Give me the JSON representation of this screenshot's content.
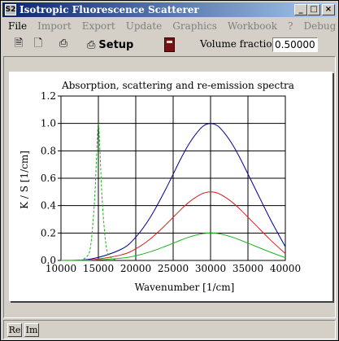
{
  "window": {
    "title": "Isotropic Fluorescence Scatterer",
    "icon_text": "S2",
    "controls": {
      "minimize": "_",
      "maximize": "□",
      "close": "×"
    }
  },
  "menu": [
    "File",
    "Import",
    "Export",
    "Update",
    "Graphics",
    "Workbook",
    "?",
    "Debug"
  ],
  "toolbar": {
    "icons": [
      "new-document-icon",
      "open-document-icon",
      "print-icon",
      "print-setup-icon",
      "device-icon"
    ],
    "setup_label": "Setup",
    "volume_fraction_label": "Volume fraction:",
    "volume_fraction_value": "0.50000"
  },
  "status": {
    "re_label": "Re",
    "im_label": "Im"
  },
  "chart_data": {
    "type": "line",
    "title": "Absorption, scattering and re-emission spectra",
    "xlabel": "Wavenumber [1/cm]",
    "ylabel": "K / S [1/cm]",
    "xlim": [
      10000,
      40000
    ],
    "ylim": [
      0,
      1.2
    ],
    "xticks": [
      10000,
      15000,
      20000,
      25000,
      30000,
      35000,
      40000
    ],
    "yticks": [
      0.0,
      0.2,
      0.4,
      0.6,
      0.8,
      1.0,
      1.2
    ],
    "ytick_labels": [
      "0.0",
      "0.2",
      "0.4",
      "0.6",
      "0.8",
      "1.0",
      "1.2"
    ],
    "grid": true,
    "legend": "none",
    "series": [
      {
        "color": "#00008b",
        "style": "solid",
        "x": [
          10000,
          14000,
          18000,
          20000,
          22000,
          24000,
          26000,
          27000,
          28000,
          29000,
          30000,
          31000,
          32000,
          33000,
          34000,
          36000,
          38000,
          40000
        ],
        "y": [
          0.0,
          0.01,
          0.08,
          0.17,
          0.32,
          0.52,
          0.74,
          0.84,
          0.92,
          0.98,
          1.0,
          0.98,
          0.92,
          0.84,
          0.74,
          0.52,
          0.3,
          0.1
        ]
      },
      {
        "color": "#d42020",
        "style": "solid",
        "x": [
          10000,
          14000,
          18000,
          20000,
          22000,
          24000,
          26000,
          27000,
          28000,
          29000,
          30000,
          31000,
          32000,
          33000,
          34000,
          36000,
          38000,
          40000
        ],
        "y": [
          0.0,
          0.005,
          0.04,
          0.085,
          0.16,
          0.26,
          0.37,
          0.42,
          0.46,
          0.49,
          0.5,
          0.49,
          0.46,
          0.42,
          0.37,
          0.26,
          0.15,
          0.05
        ]
      },
      {
        "color": "#20b020",
        "style": "solid",
        "x": [
          10000,
          14000,
          18000,
          20000,
          22000,
          24000,
          26000,
          27000,
          28000,
          29000,
          30000,
          31000,
          32000,
          33000,
          34000,
          36000,
          38000,
          40000
        ],
        "y": [
          0.0,
          0.002,
          0.016,
          0.034,
          0.064,
          0.104,
          0.148,
          0.168,
          0.184,
          0.196,
          0.2,
          0.196,
          0.184,
          0.168,
          0.148,
          0.104,
          0.06,
          0.02
        ]
      },
      {
        "color": "#20b020",
        "style": "dashed",
        "x": [
          12500,
          13500,
          14000,
          14500,
          14800,
          15000,
          15200,
          15500,
          16000,
          16500,
          17500
        ],
        "y": [
          0.0,
          0.03,
          0.12,
          0.45,
          0.82,
          1.0,
          0.82,
          0.45,
          0.12,
          0.03,
          0.0
        ]
      }
    ]
  }
}
